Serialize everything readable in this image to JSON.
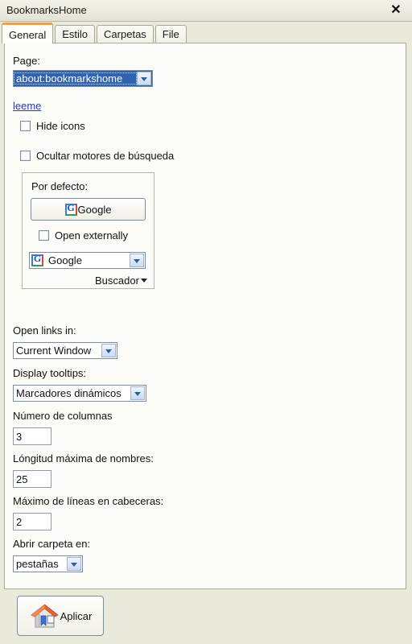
{
  "window": {
    "title": "BookmarksHome",
    "close_label": "✕"
  },
  "tabs": [
    {
      "label": "General",
      "active": true
    },
    {
      "label": "Estilo",
      "active": false
    },
    {
      "label": "Carpetas",
      "active": false
    },
    {
      "label": "File",
      "active": false
    }
  ],
  "general": {
    "page_label": "Page:",
    "page_value": "about:bookmarkshome",
    "readme_link": "leeme",
    "hide_icons_label": "Hide icons",
    "hide_icons_checked": false,
    "hide_search_engines_label": "Ocultar motores de búsqueda",
    "hide_search_engines_checked": false,
    "group": {
      "legend": "Por defecto:",
      "default_engine_button": "Google",
      "open_externally_label": "Open externally",
      "open_externally_checked": false,
      "engine_select_value": "Google",
      "search_menu_label": "Buscador"
    },
    "open_links_label": "Open links in:",
    "open_links_value": "Current Window",
    "tooltips_label": "Display tooltips:",
    "tooltips_value": "Marcadores dinámicos",
    "columns_label": "Número de columnas",
    "columns_value": "3",
    "max_name_length_label": "Lóngitud máxima de nombres:",
    "max_name_length_value": "25",
    "max_header_lines_label": "Máximo de líneas en cabeceras:",
    "max_header_lines_value": "2",
    "open_folder_label": "Abrir carpeta en:",
    "open_folder_value": "pestañas"
  },
  "footer": {
    "apply_label": "Aplicar"
  },
  "colors": {
    "accent_tab": "#f2a13a",
    "selected_bg": "#2f63b0",
    "link": "#2b35c8",
    "window_bg": "#e9e9dc",
    "panel_bg": "#fbfbf7"
  }
}
